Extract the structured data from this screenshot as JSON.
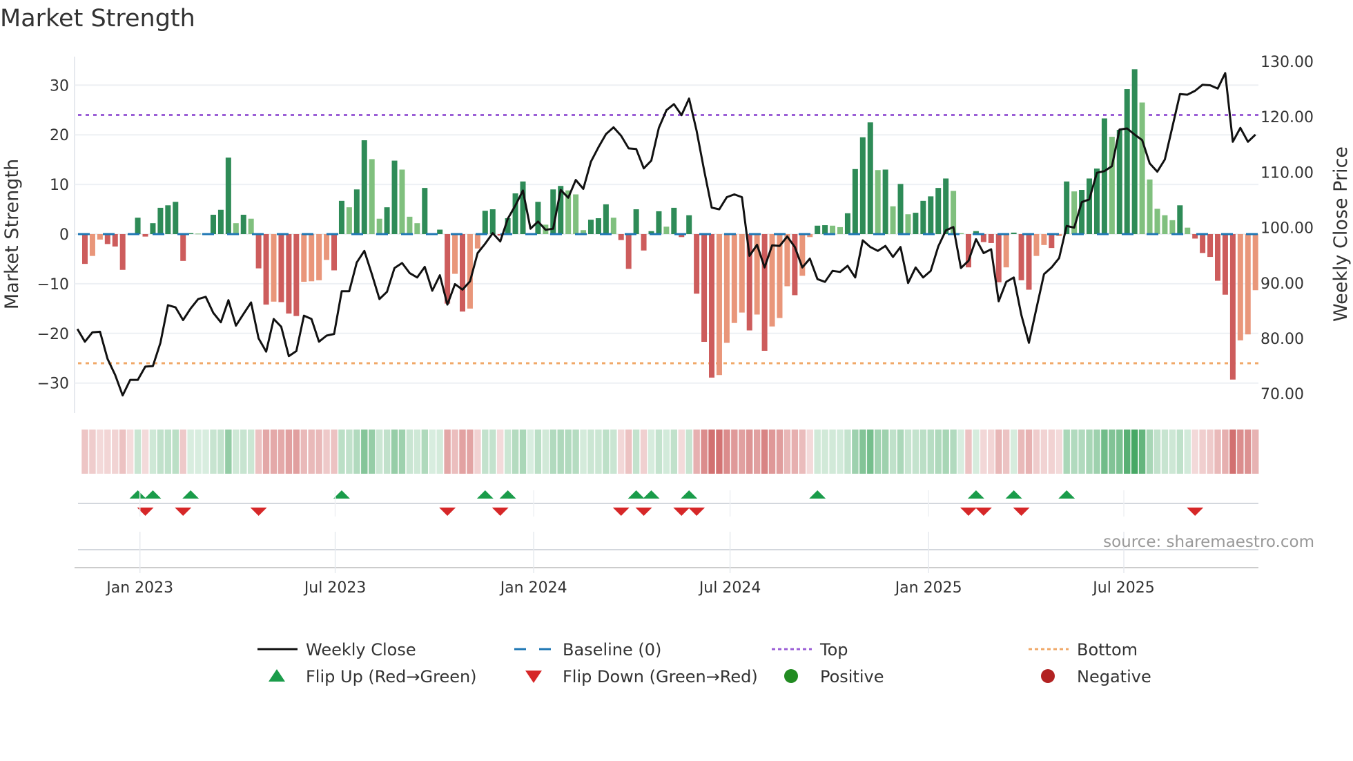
{
  "chart_data": {
    "type": "bar",
    "title": "Market Strength",
    "ylabel": "Market Strength",
    "y2label": "Weekly Close Price",
    "ylim": [
      -36,
      36
    ],
    "y2lim": [
      68,
      132
    ],
    "yticks": [
      30,
      20,
      10,
      0,
      -10,
      -20,
      -30
    ],
    "yticklabels": [
      "30",
      "20",
      "10",
      "0",
      "−10",
      "−20",
      "−30"
    ],
    "y2ticks": [
      130,
      120,
      110,
      100,
      90,
      80,
      70
    ],
    "y2ticklabels": [
      "130.00",
      "120.00",
      "110.00",
      "100.00",
      "90.00",
      "80.00",
      "70.00"
    ],
    "start_week": "2022-11-11",
    "xticks": [
      {
        "date": "2023-01-01",
        "label": "Jan 2023"
      },
      {
        "date": "2023-07-01",
        "label": "Jul 2023"
      },
      {
        "date": "2024-01-01",
        "label": "Jan 2024"
      },
      {
        "date": "2024-07-01",
        "label": "Jul 2024"
      },
      {
        "date": "2025-01-01",
        "label": "Jan 2025"
      },
      {
        "date": "2025-07-01",
        "label": "Jul 2025"
      }
    ],
    "top_level": 24,
    "bottom_level": -26,
    "baseline": 0,
    "strength": [
      -6.0,
      -4.4,
      -1.1,
      -2.0,
      -2.5,
      -7.2,
      -0.2,
      3.3,
      -0.5,
      2.2,
      5.3,
      5.8,
      6.5,
      -5.4,
      0.2,
      0.1,
      0.1,
      3.9,
      4.9,
      15.4,
      2.2,
      3.9,
      3.1,
      -6.9,
      -14.2,
      -13.6,
      -13.7,
      -16.0,
      -16.5,
      -9.6,
      -9.5,
      -9.3,
      -5.2,
      -7.3,
      6.7,
      5.4,
      9.0,
      18.9,
      15.1,
      3.1,
      5.4,
      14.8,
      13.0,
      3.5,
      2.2,
      9.3,
      0.2,
      0.9,
      -14.0,
      -8.0,
      -15.6,
      -15.0,
      -2.9,
      4.7,
      5.0,
      -0.3,
      3.2,
      8.2,
      10.6,
      0.2,
      6.5,
      1.9,
      9.0,
      9.7,
      8.8,
      8.0,
      0.8,
      2.9,
      3.2,
      6.0,
      3.3,
      -1.2,
      -7.0,
      5.0,
      -3.3,
      0.6,
      4.6,
      1.5,
      5.3,
      -0.6,
      3.8,
      -12.0,
      -21.7,
      -28.9,
      -28.4,
      -21.9,
      -17.9,
      -15.8,
      -19.4,
      -16.2,
      -23.5,
      -18.6,
      -16.9,
      -10.5,
      -12.3,
      -8.4,
      -0.6,
      1.7,
      1.8,
      1.7,
      1.4,
      4.2,
      13.1,
      19.5,
      22.5,
      12.9,
      13.0,
      5.6,
      10.1,
      4.0,
      4.3,
      6.7,
      7.6,
      9.3,
      11.2,
      8.7,
      0.2,
      -6.7,
      0.6,
      -1.6,
      -1.8,
      -9.7,
      -6.7,
      0.3,
      -9.3,
      -11.2,
      -4.4,
      -2.2,
      -2.8,
      -0.4,
      10.6,
      8.6,
      8.9,
      11.2,
      13.2,
      23.3,
      19.6,
      21.0,
      29.2,
      33.2,
      26.5,
      11.0,
      5.1,
      3.8,
      2.8,
      5.8,
      1.3,
      -0.9,
      -3.8,
      -4.6,
      -9.4,
      -12.2,
      -29.3,
      -21.4,
      -20.2,
      -11.3
    ],
    "weekly_close": [
      81.7,
      79.4,
      81.1,
      81.2,
      76.3,
      73.4,
      69.7,
      72.5,
      72.5,
      74.9,
      75.0,
      79.2,
      86.0,
      85.6,
      83.3,
      85.4,
      87.1,
      87.5,
      84.6,
      82.9,
      86.9,
      82.3,
      84.4,
      86.5,
      80.0,
      77.6,
      83.5,
      82.1,
      76.8,
      77.7,
      84.1,
      83.5,
      79.4,
      80.5,
      80.8,
      88.5,
      88.5,
      93.7,
      95.8,
      91.6,
      87.1,
      88.4,
      92.7,
      93.6,
      91.8,
      91.0,
      92.9,
      88.6,
      91.4,
      86.1,
      89.8,
      88.8,
      90.3,
      95.4,
      97.1,
      99.0,
      97.5,
      101.6,
      104.0,
      106.7,
      99.8,
      101.1,
      99.6,
      99.8,
      106.8,
      105.4,
      108.6,
      107.0,
      111.9,
      114.5,
      116.9,
      118.1,
      116.6,
      114.3,
      114.2,
      110.7,
      112.1,
      118.0,
      121.2,
      122.3,
      120.3,
      123.3,
      117.5,
      110.3,
      103.6,
      103.3,
      105.5,
      106.0,
      105.5,
      94.9,
      96.9,
      92.8,
      96.8,
      96.7,
      98.4,
      96.5,
      92.8,
      94.4,
      90.7,
      90.2,
      92.2,
      92.0,
      93.1,
      91.0,
      97.7,
      96.5,
      95.8,
      96.7,
      94.7,
      96.5,
      90.0,
      92.8,
      91.0,
      92.2,
      96.6,
      99.5,
      100.1,
      92.7,
      94.0,
      97.9,
      95.4,
      96.1,
      86.7,
      90.2,
      91.0,
      84.2,
      79.2,
      85.4,
      91.6,
      92.8,
      94.5,
      100.3,
      100.0,
      104.6,
      105.1,
      109.9,
      110.2,
      111.1,
      117.7,
      117.9,
      116.8,
      115.8,
      111.6,
      110.1,
      112.3,
      118.2,
      124.1,
      124.0,
      124.7,
      125.8,
      125.7,
      125.1,
      127.9,
      115.5,
      118.0,
      115.5,
      116.8
    ],
    "legend": {
      "placement": "bottom",
      "items": [
        {
          "key": "weekly_close",
          "label": "Weekly Close"
        },
        {
          "key": "baseline",
          "label": "Baseline (0)"
        },
        {
          "key": "top",
          "label": "Top"
        },
        {
          "key": "bottom",
          "label": "Bottom"
        },
        {
          "key": "flip_up",
          "label": "Flip Up (Red→Green)"
        },
        {
          "key": "flip_down",
          "label": "Flip Down (Green→Red)"
        },
        {
          "key": "positive",
          "label": "Positive"
        },
        {
          "key": "negative",
          "label": "Negative"
        }
      ]
    },
    "source": "source: sharemaestro.com",
    "grid": true
  },
  "colors": {
    "green_rising": "#2e8b57",
    "green_falling": "#80c07e",
    "red_falling": "#cd5c5c",
    "red_rising": "#e9967a",
    "line": "#111111",
    "baseline": "#1f77b4",
    "top": "#9b5fd6",
    "bottom": "#f0a868",
    "flip_up": "#1a9c4a",
    "flip_down": "#d62728",
    "positive": "#228b22",
    "negative": "#b22222",
    "grid": "#edf0f4"
  }
}
